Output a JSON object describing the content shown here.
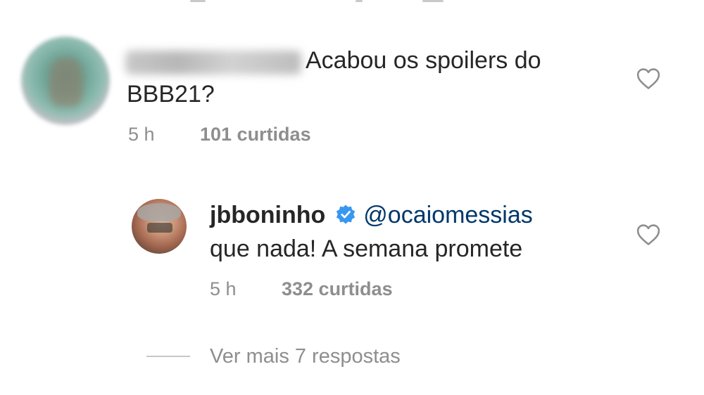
{
  "comments": [
    {
      "username_hidden": true,
      "text_line1": "Acabou os spoilers do",
      "text_line2": "BBB21?",
      "time": "5 h",
      "likes": "101 curtidas"
    },
    {
      "username": "jbboninho",
      "verified": true,
      "mention": "@ocaiomessias",
      "text": "que nada! A semana promete",
      "time": "5 h",
      "likes": "332 curtidas"
    }
  ],
  "view_more_replies": "Ver mais 7 respostas",
  "colors": {
    "text": "#262626",
    "meta": "#8e8e8e",
    "mention": "#00376b",
    "verified": "#3897f0"
  },
  "icons": [
    "heart-icon",
    "verified-badge-icon"
  ]
}
